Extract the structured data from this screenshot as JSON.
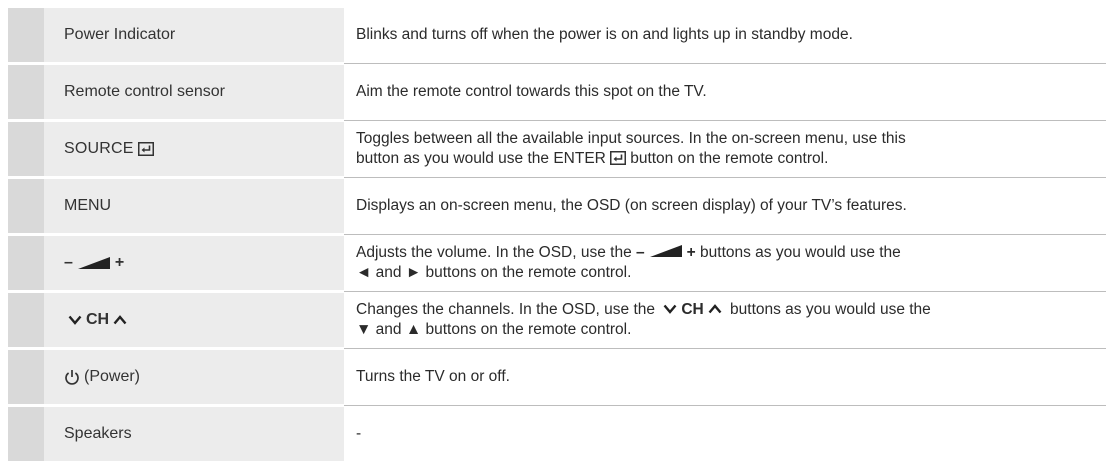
{
  "rows": [
    {
      "control": "Power Indicator",
      "description": "Blinks and turns off when the power is on and lights up in standby mode."
    },
    {
      "control": "Remote control sensor",
      "description": "Aim the remote control towards this spot on the TV."
    },
    {
      "control": "SOURCE",
      "description_line1": "Toggles between all the available input sources. In the on-screen menu, use this",
      "description_line2_a": "button as you would use the",
      "description_line2_b": "ENTER",
      "description_line2_c": "button on the remote control."
    },
    {
      "control": "MENU",
      "description": "Displays an on-screen menu, the OSD (on screen display) of your TV’s features."
    },
    {
      "control_minus": "–",
      "control_plus": "+",
      "description_line1_a": "Adjusts the volume. In the OSD, use the",
      "description_line1_minus": "–",
      "description_line1_plus": "+",
      "description_line1_b": "buttons as you would use the",
      "description_line2_left": "◄",
      "description_line2_mid": "and",
      "description_line2_right": "►",
      "description_line2_b": "buttons on the remote control."
    },
    {
      "control": "CH",
      "description_line1_a": "Changes the channels. In the OSD, use the",
      "description_line1_ch": "CH",
      "description_line1_b": "buttons as you would use the",
      "description_line2_down": "▼",
      "description_line2_mid": "and",
      "description_line2_up": "▲",
      "description_line2_b": "buttons on the remote control."
    },
    {
      "control": "(Power)",
      "description": "Turns the TV on or off."
    },
    {
      "control": "Speakers",
      "description": "-"
    }
  ],
  "icons": {
    "enter": "enter-icon",
    "volume": "volume-wedge-icon",
    "chevron_down": "chevron-down-icon",
    "chevron_up": "chevron-up-icon",
    "power": "power-icon"
  }
}
